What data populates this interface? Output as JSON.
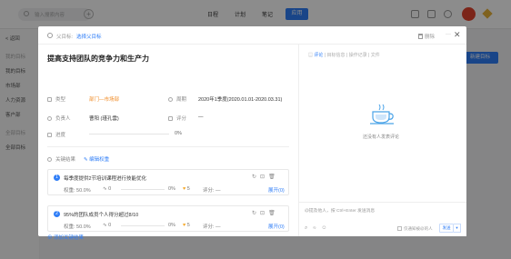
{
  "topbar": {
    "search_placeholder": "输入搜索内容",
    "nav": [
      "日程",
      "计划",
      "笔记"
    ],
    "app_label": "应用"
  },
  "sidebar": {
    "back": "< 返回",
    "section1": "我的目标",
    "items1": [
      "我的目标",
      "市场部",
      "人力资源",
      "客户部"
    ],
    "section2": "全部目标",
    "items2": [
      "全部目标"
    ]
  },
  "new_goal_label": "新建目标",
  "modal": {
    "parent_label": "父目标:",
    "parent_link": "选择父目标",
    "delete_label": "删除",
    "more": "···",
    "close": "✕",
    "title": "提高支持团队的竞争力和生产力",
    "fields": {
      "type_label": "类型",
      "type_value": "部门—市场部",
      "period_label": "周期",
      "period_value": "2020年1季度(2020.01.01-2020.03.31)",
      "owner_label": "负责人",
      "owner_value": "曹阳 (瑾孔雲)",
      "score_label": "评分",
      "score_value": "—",
      "progress_label": "进度",
      "progress_value": "0%",
      "progress_fraction": 0
    },
    "kr_section": {
      "label": "关键结果",
      "edit_weight": "编辑权重",
      "items": [
        {
          "num": "1",
          "title": "每季度提供2节培训课程进行技能优化",
          "weight": "权重: 50.0%",
          "links": "0",
          "progress": "0%",
          "likes": "5",
          "score": "评分: —",
          "expand": "展开(0)"
        },
        {
          "num": "2",
          "title": "95%的团队成员个人得分超过8/10",
          "weight": "权重: 50.0%",
          "links": "0",
          "progress": "0%",
          "likes": "5",
          "score": "评分: —",
          "expand": "展开(0)"
        }
      ],
      "add_label": "⊕ 添加关键结果"
    },
    "right": {
      "tabs": [
        "评论",
        "目标信息",
        "操作记录",
        "文件"
      ],
      "empty_text": "还没有人发表评论",
      "comment_placeholder": "@提及他人，按 Ctrl+Enter 发送消息",
      "notify_label": "仅通知被@的人",
      "send_label": "发送",
      "send_dropdown": "▾"
    }
  }
}
